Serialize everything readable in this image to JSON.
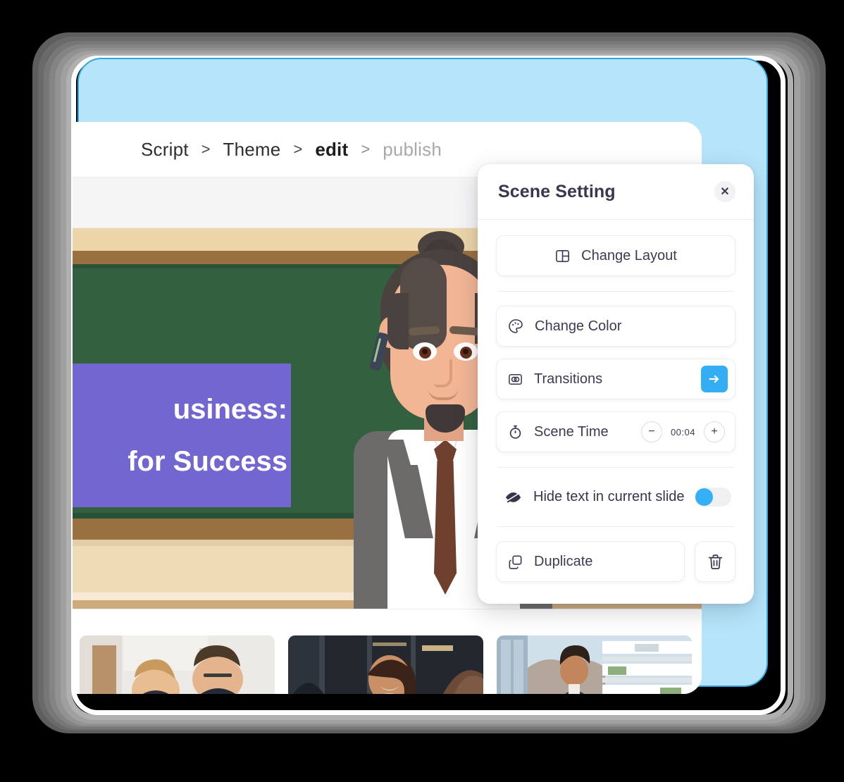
{
  "window": {
    "backdrop_color": "#b6e5fb",
    "backdrop_border_color": "#35a6db"
  },
  "breadcrumb": {
    "items": [
      {
        "label": "Script",
        "state": "normal"
      },
      {
        "label": "Theme",
        "state": "normal"
      },
      {
        "label": "edit",
        "state": "active"
      },
      {
        "label": "publish",
        "state": "muted"
      }
    ],
    "separator": ">"
  },
  "slide": {
    "text_lines": [
      "usiness:",
      "for Success"
    ],
    "textbox_color": "#7266d0",
    "board_color": "#33603f",
    "wall_color": "#ecd5a9",
    "trim_color": "#99703f",
    "character": {
      "description": "presenter-illustration",
      "suit_color": "#6c6b6a",
      "tie_color": "#70402f",
      "skin_color": "#f3b695",
      "hair_color": "#4a423f"
    }
  },
  "thumbnails": [
    {
      "name": "thumbnail-1",
      "alt": "two-people-reviewing-document"
    },
    {
      "name": "thumbnail-2",
      "alt": "woman-smiling-in-meeting"
    },
    {
      "name": "thumbnail-3",
      "alt": "man-in-front-of-modern-building"
    }
  ],
  "scene_panel": {
    "title": "Scene Setting",
    "close_label": "✕",
    "change_layout": {
      "label": "Change Layout",
      "icon": "layout-icon"
    },
    "change_color": {
      "label": "Change Color",
      "icon": "palette-icon"
    },
    "transitions": {
      "label": "Transitions",
      "icon": "transition-icon",
      "action_icon": "arrow-right-icon",
      "action_color": "#33aef5"
    },
    "scene_time": {
      "label": "Scene Time",
      "icon": "stopwatch-icon",
      "value": "00:04",
      "decrement_label": "−",
      "increment_label": "+"
    },
    "hide_text": {
      "label": "Hide text in current slide",
      "icon": "eye-off-icon",
      "toggle_on": true,
      "toggle_color": "#33b0f6"
    },
    "duplicate": {
      "label": "Duplicate",
      "icon": "copy-icon"
    },
    "delete": {
      "label": "",
      "icon": "trash-icon"
    }
  }
}
